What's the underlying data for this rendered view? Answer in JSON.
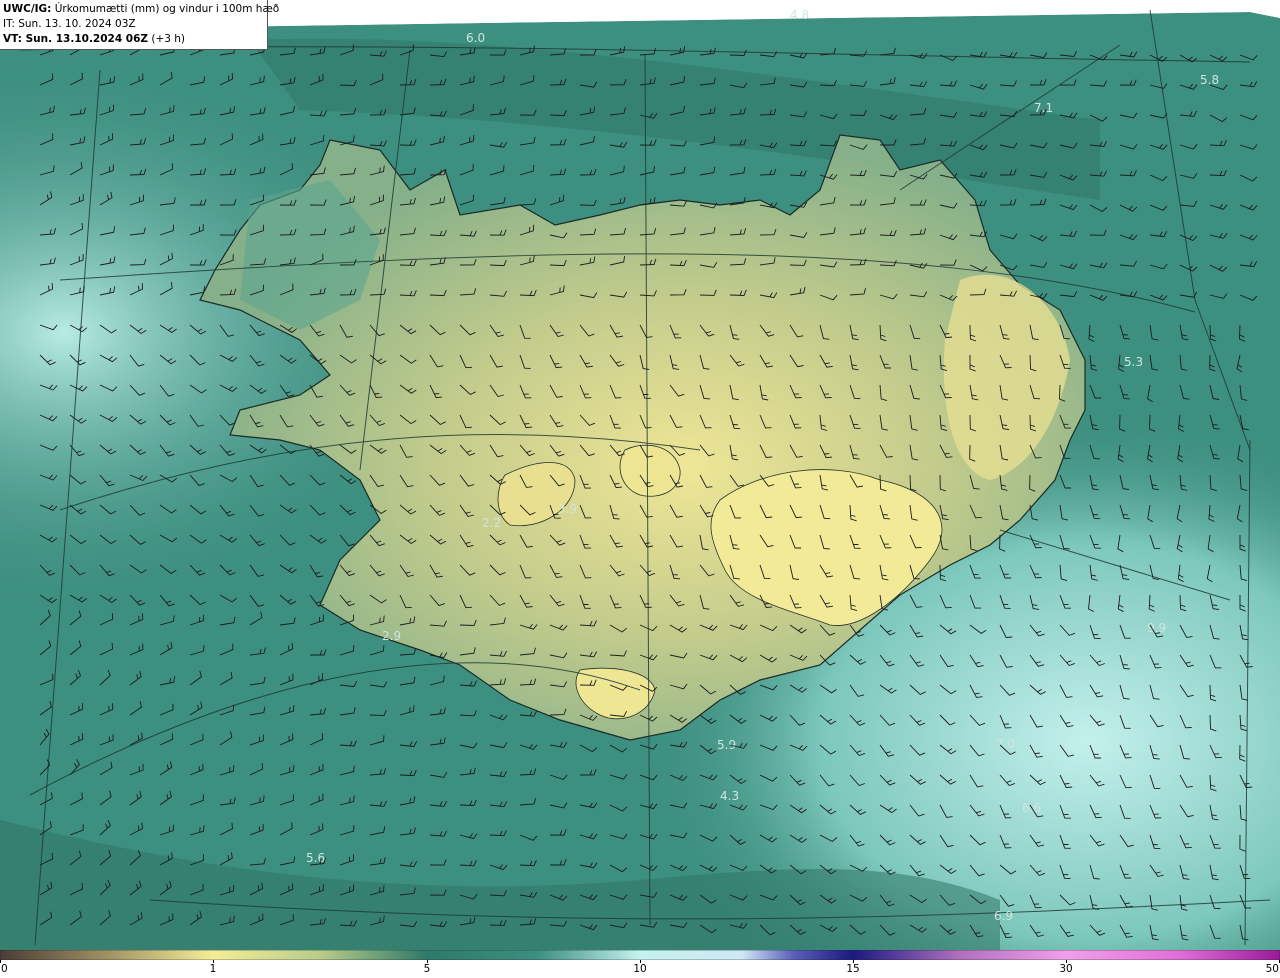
{
  "header": {
    "product": "UWC/IG:",
    "description": "Úrkomumætti (mm) og vindur i 100m hæð",
    "it_line": "IT: Sun. 13. 10. 2024 03Z",
    "vt_prefix": "VT: Sun. 13.10.2024 06Z",
    "vt_suffix": " (+3 h)"
  },
  "colorbar": {
    "ticks": [
      "0",
      "1",
      "5",
      "10",
      "15",
      "30",
      "50"
    ],
    "colors": [
      "#4a3c36",
      "#9c8e62",
      "#f3ed96",
      "#b9cc8c",
      "#2f7a6a",
      "#3d8f80",
      "#c4f2ee",
      "#cfe7f5",
      "#5a5fb8",
      "#1a1a80",
      "#b070c0",
      "#f0a0e8",
      "#e070d8",
      "#9a1a9a"
    ]
  },
  "map": {
    "ocean_color": "#3d8f7f",
    "land_color": "#dcd98c",
    "coast_color": "#1a2a26",
    "value_labels": [
      "4.8",
      "6.0",
      "5.8",
      "7.1",
      "5.3",
      "3.9",
      "2.9",
      "9.9",
      "5.9",
      "4.3",
      "6.6",
      "5.6",
      "6.9",
      "7.0",
      "2.2"
    ]
  }
}
